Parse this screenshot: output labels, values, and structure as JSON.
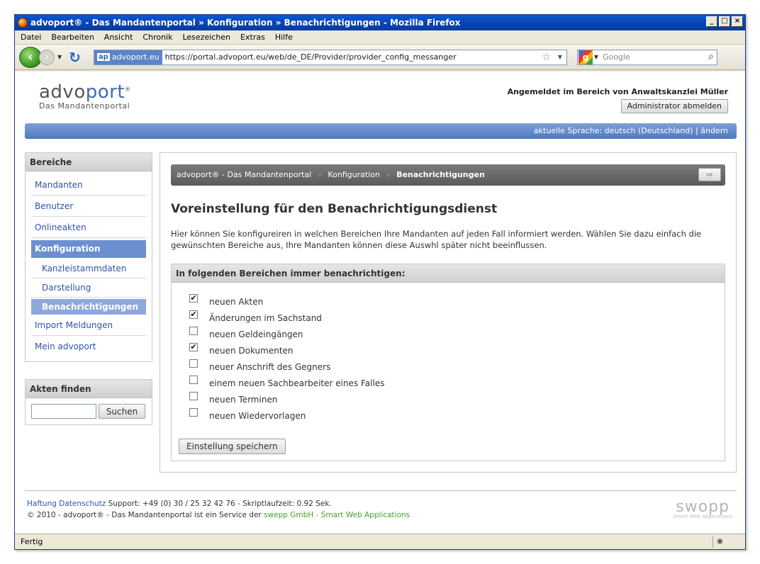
{
  "browser": {
    "title": "advoport® - Das Mandantenportal » Konfiguration » Benachrichtigungen - Mozilla Firefox",
    "menu": [
      "Datei",
      "Bearbeiten",
      "Ansicht",
      "Chronik",
      "Lesezeichen",
      "Extras",
      "Hilfe"
    ],
    "site_identity": "advoport.eu",
    "site_badge": "ap",
    "url": "https://portal.advoport.eu/web/de_DE/Provider/provider_config_messanger",
    "search_placeholder": "Google",
    "status": "Fertig"
  },
  "header": {
    "logo_advo": "advo",
    "logo_port": "port",
    "logo_reg": "®",
    "logo_sub": "Das Mandantenportal",
    "logged_in": "Angemeldet im Bereich von Anwaltskanzlei Müller",
    "logout_label": "Administrator abmelden",
    "language": "aktuelle Sprache: deutsch (Deutschland) | ändern"
  },
  "sidebar": {
    "areas_title": "Bereiche",
    "items": [
      {
        "label": "Mandanten"
      },
      {
        "label": "Benutzer"
      },
      {
        "label": "Onlineakten"
      },
      {
        "label": "Konfiguration"
      },
      {
        "label": "Kanzleistammdaten"
      },
      {
        "label": "Darstellung"
      },
      {
        "label": "Benachrichtigungen"
      },
      {
        "label": "Import Meldungen"
      },
      {
        "label": "Mein advoport"
      }
    ],
    "search_title": "Akten finden",
    "search_button": "Suchen",
    "search_value": ""
  },
  "breadcrumb": {
    "items": [
      "advoport® - Das Mandantenportal",
      "Konfiguration",
      "Benachrichtigungen"
    ],
    "separator": "»"
  },
  "main": {
    "title": "Voreinstellung für den Benachrichtigungsdienst",
    "intro": "Hier können Sie konfigureiren in welchen Bereichen Ihre Mandanten auf jeden Fall informiert werden. Wählen Sie dazu einfach die gewünschten Bereiche aus, Ihre Mandanten können diese Auswhl später nicht beeinflussen.",
    "panel_title": "In folgenden Bereichen immer benachrichtigen:",
    "options": [
      {
        "label": "neuen Akten",
        "checked": true
      },
      {
        "label": "Änderungen im Sachstand",
        "checked": true
      },
      {
        "label": "neuen Geldeingängen",
        "checked": false
      },
      {
        "label": "neuen Dokumenten",
        "checked": true
      },
      {
        "label": "neuer Anschrift des Gegners",
        "checked": false
      },
      {
        "label": "einem neuen Sachbearbeiter eines Falles",
        "checked": false
      },
      {
        "label": "neuen Terminen",
        "checked": false
      },
      {
        "label": "neuen Wiedervorlagen",
        "checked": false
      }
    ],
    "save_label": "Einstellung speichern"
  },
  "footer": {
    "link_haftung": "Haftung",
    "link_datenschutz": "Datenschutz",
    "support": "Support: +49 (0) 30 / 25 32 42 76 - Skriptlaufzeit: 0.92 Sek.",
    "copyright": "© 2010 - advoport® - Das Mandantenportal ist ein Service der",
    "swepp_link": "swepp GmbH - Smart Web Applications",
    "swopp_logo": "swopp",
    "swopp_sub": "Smart Web Applications"
  }
}
